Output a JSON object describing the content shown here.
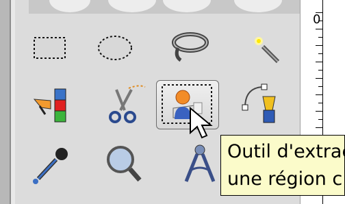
{
  "ruler": {
    "label": "0"
  },
  "tooltip": {
    "line1": "Outil d'extrac",
    "line2": "une région c"
  },
  "tools": [
    {
      "name": "rect-select-tool"
    },
    {
      "name": "ellipse-select-tool"
    },
    {
      "name": "free-select-tool"
    },
    {
      "name": "fuzzy-select-tool"
    },
    {
      "name": "select-by-color-tool"
    },
    {
      "name": "scissors-select-tool"
    },
    {
      "name": "foreground-select-tool",
      "active": true
    },
    {
      "name": "paths-tool"
    },
    {
      "name": "color-picker-tool"
    },
    {
      "name": "zoom-tool"
    },
    {
      "name": "measure-tool"
    }
  ]
}
